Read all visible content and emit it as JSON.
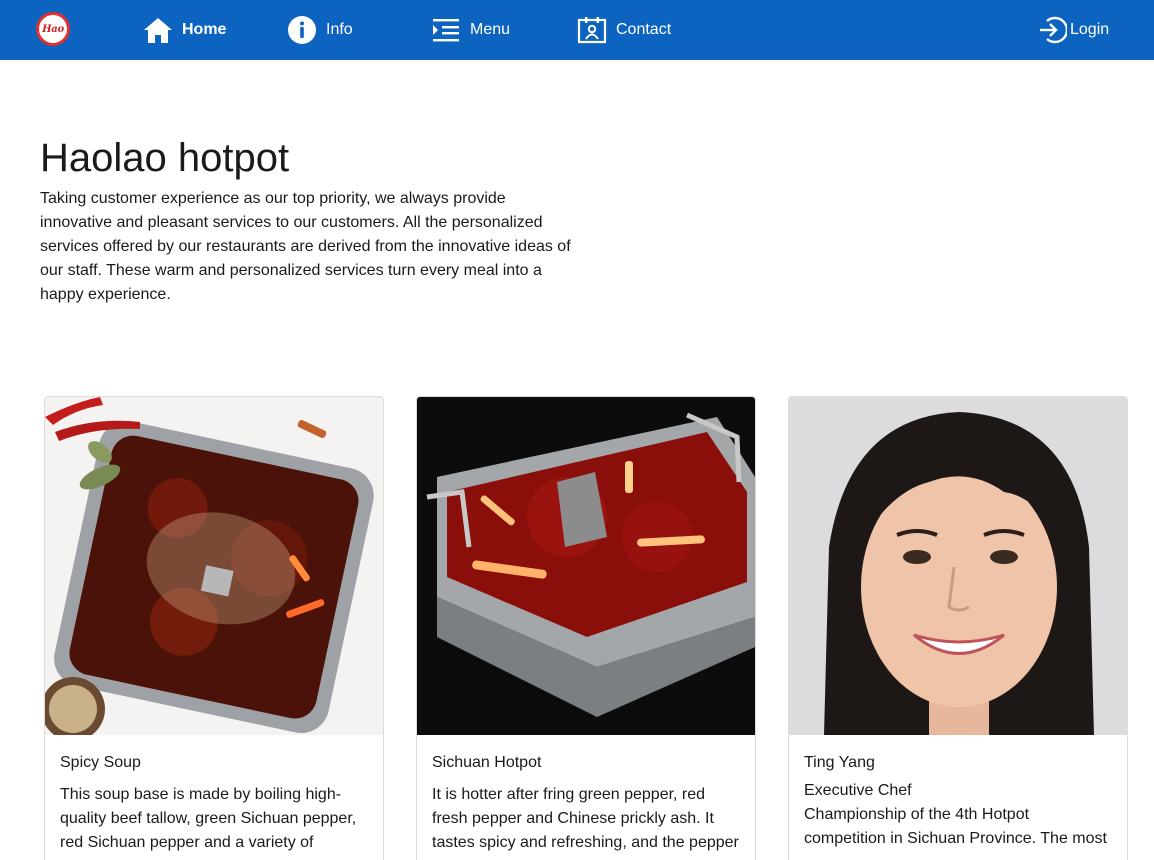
{
  "nav": {
    "logo_text": "Hao",
    "home": "Home",
    "info": "Info",
    "menu": "Menu",
    "contact": "Contact",
    "login": "Login"
  },
  "hero": {
    "title": "Haolao hotpot",
    "text": "Taking customer experience as our top priority, we always provide innovative and pleasant services to our customers. All the personalized services offered by our restaurants are derived from the innovative ideas of our staff. These warm and personalized services turn every meal into a happy experience."
  },
  "cards": [
    {
      "title": "Spicy Soup",
      "text": "This soup base is made by boiling high-quality beef tallow, green Sichuan pepper, red Sichuan pepper and a variety of"
    },
    {
      "title": "Sichuan Hotpot",
      "text": "It is hotter after fring green pepper, red fresh pepper and Chinese prickly ash. It tastes spicy and refreshing, and the pepper"
    },
    {
      "title": "Ting Yang",
      "subtitle": "Executive Chef",
      "text": "Championship of the 4th Hotpot competition in Sichuan Province. The most"
    }
  ],
  "colors": {
    "navbar": "#0d64c0",
    "logo_ring": "#e03030"
  },
  "icons": [
    "home-icon",
    "info-icon",
    "menu-icon",
    "contact-icon",
    "login-icon"
  ]
}
